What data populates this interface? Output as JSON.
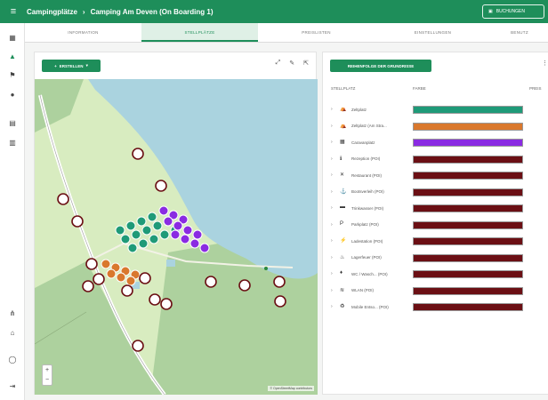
{
  "topbar": {
    "breadcrumb_root": "Campingplätze",
    "breadcrumb_separator": "›",
    "breadcrumb_current": "Camping Am Deven (On Boarding 1)",
    "action_label": "BUCHUNGEN"
  },
  "tabs": [
    {
      "label": "INFORMATION",
      "active": false
    },
    {
      "label": "STELLPLÄTZE",
      "active": true
    },
    {
      "label": "PREISLISTEN",
      "active": false
    },
    {
      "label": "EINSTELLUNGEN",
      "active": false
    },
    {
      "label": "BENUTZ",
      "active": false
    }
  ],
  "map_panel": {
    "create_label": "ERSTELLEN",
    "zoom_in": "+",
    "zoom_out": "−",
    "attribution": "© OpenStreetMap contributors"
  },
  "list_panel": {
    "button_label": "REIHENFOLGE DER GRUNDRISSE",
    "col_stellplatz": "STELLPLATZ",
    "col_farbe": "FARBE",
    "col_preis": "PREIS",
    "rows": [
      {
        "label": "Zeltplatz",
        "color": "#1f9a78",
        "icon": "tent-icon",
        "glyph": "⛺"
      },
      {
        "label": "Zeltplatz (Am Stra...",
        "color": "#d9782d",
        "icon": "tent-icon",
        "glyph": "⛺"
      },
      {
        "label": "Caravanplatz",
        "color": "#8a2be2",
        "icon": "caravan-icon",
        "glyph": "▦"
      },
      {
        "label": "Rezeption (POI)",
        "color": "#6b0f14",
        "icon": "info-icon",
        "glyph": "ℹ"
      },
      {
        "label": "Restaurant (POI)",
        "color": "#6b0f14",
        "icon": "restaurant-icon",
        "glyph": "✕"
      },
      {
        "label": "Bootsverleih (POI)",
        "color": "#6b0f14",
        "icon": "boat-icon",
        "glyph": "⚓"
      },
      {
        "label": "Trinkwasser (POI)",
        "color": "#6b0f14",
        "icon": "water-icon",
        "glyph": "▬"
      },
      {
        "label": "Parkplatz (POI)",
        "color": "#6b0f14",
        "icon": "parking-icon",
        "glyph": "P"
      },
      {
        "label": "Ladestation (POI)",
        "color": "#6b0f14",
        "icon": "charging-icon",
        "glyph": "⚡"
      },
      {
        "label": "Lagerfeuer (POI)",
        "color": "#6b0f14",
        "icon": "fire-icon",
        "glyph": "♨"
      },
      {
        "label": "WC / Wasch... (POI)",
        "color": "#6b0f14",
        "icon": "wc-icon",
        "glyph": "♦"
      },
      {
        "label": "WLAN (POI)",
        "color": "#6b0f14",
        "icon": "wifi-icon",
        "glyph": "≋"
      },
      {
        "label": "Mobile Entso... (POI)",
        "color": "#6b0f14",
        "icon": "recycling-icon",
        "glyph": "♻"
      }
    ]
  },
  "colors": {
    "brand": "#1e8e5a",
    "lake": "#aad3df",
    "grass": "#d8ecc0",
    "forest": "#add19e"
  }
}
